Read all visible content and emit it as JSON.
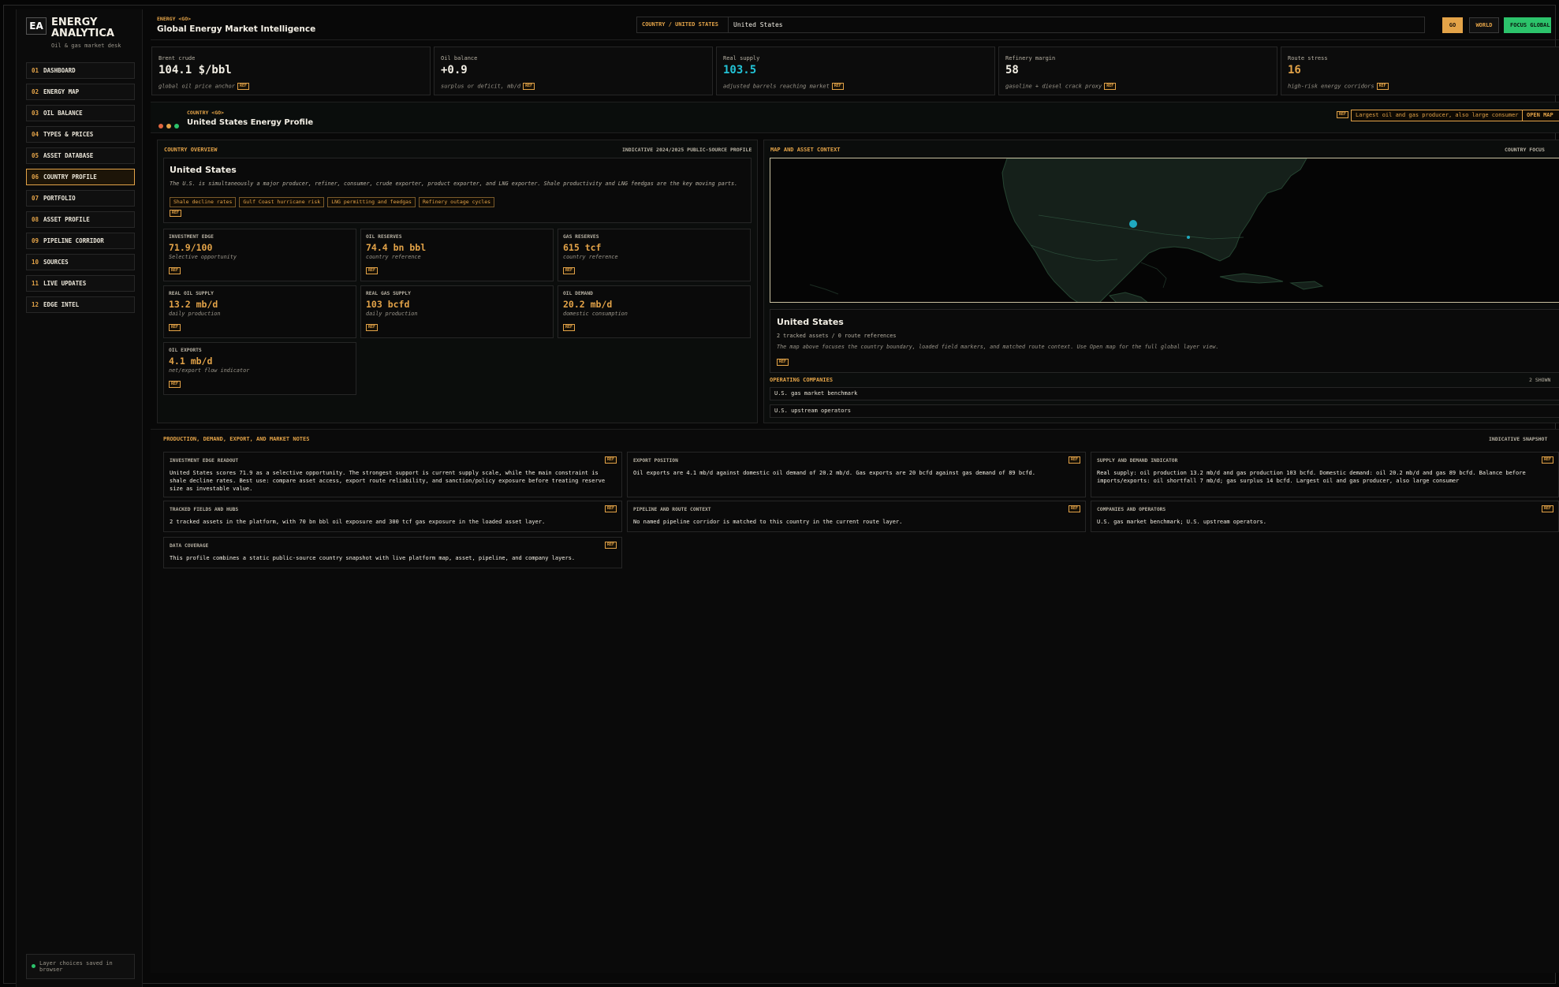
{
  "brand": {
    "logo": "EA",
    "name": "ENERGY ANALYTICA",
    "subtitle": "Oil & gas market desk"
  },
  "nav": [
    {
      "num": "01",
      "label": "DASHBOARD"
    },
    {
      "num": "02",
      "label": "ENERGY MAP"
    },
    {
      "num": "03",
      "label": "OIL BALANCE"
    },
    {
      "num": "04",
      "label": "TYPES & PRICES"
    },
    {
      "num": "05",
      "label": "ASSET DATABASE"
    },
    {
      "num": "06",
      "label": "COUNTRY PROFILE",
      "active": true
    },
    {
      "num": "07",
      "label": "PORTFOLIO"
    },
    {
      "num": "08",
      "label": "ASSET PROFILE"
    },
    {
      "num": "09",
      "label": "PIPELINE CORRIDOR"
    },
    {
      "num": "10",
      "label": "SOURCES"
    },
    {
      "num": "11",
      "label": "LIVE UPDATES"
    },
    {
      "num": "12",
      "label": "EDGE INTEL"
    }
  ],
  "footer_note": "Layer choices saved in browser",
  "header": {
    "kicker": "ENERGY <GO>",
    "title": "Global Energy Market Intelligence",
    "search_label": "COUNTRY / UNITED STATES",
    "search_value": "United States",
    "go_label": "GO",
    "world_label": "WORLD",
    "focus_label": "FOCUS GLOBAL"
  },
  "ref_label": "REF",
  "kpis": [
    {
      "label": "Brent crude",
      "value": "104.1 $/bbl",
      "note": "global oil price anchor",
      "tone": "white"
    },
    {
      "label": "Oil balance",
      "value": "+0.9",
      "note": "surplus or deficit, mb/d",
      "tone": "white"
    },
    {
      "label": "Real supply",
      "value": "103.5",
      "note": "adjusted barrels reaching market",
      "tone": "teal"
    },
    {
      "label": "Refinery margin",
      "value": "58",
      "note": "gasoline + diesel crack proxy",
      "tone": "white"
    },
    {
      "label": "Route stress",
      "value": "16",
      "note": "high-risk energy corridors",
      "tone": "orange"
    }
  ],
  "profile": {
    "kicker": "COUNTRY <GO>",
    "title": "United States Energy Profile",
    "tag": "Largest oil and gas producer, also large consumer",
    "open_label": "OPEN MAP"
  },
  "overview": {
    "title": "COUNTRY OVERVIEW",
    "right": "INDICATIVE 2024/2025 PUBLIC-SOURCE PROFILE",
    "name": "United States",
    "description": "The U.S. is simultaneously a major producer, refiner, consumer, crude exporter, product exporter, and LNG exporter. Shale productivity and LNG feedgas are the key moving parts.",
    "chips": [
      "Shale decline rates",
      "Gulf Coast hurricane risk",
      "LNG permitting and feedgas",
      "Refinery outage cycles"
    ],
    "metrics": [
      {
        "label": "INVESTMENT EDGE",
        "value": "71.9/100",
        "note": "Selective opportunity"
      },
      {
        "label": "OIL RESERVES",
        "value": "74.4 bn bbl",
        "note": "country reference"
      },
      {
        "label": "GAS RESERVES",
        "value": "615 tcf",
        "note": "country reference"
      },
      {
        "label": "REAL OIL SUPPLY",
        "value": "13.2 mb/d",
        "note": "daily production"
      },
      {
        "label": "REAL GAS SUPPLY",
        "value": "103 bcfd",
        "note": "daily production"
      },
      {
        "label": "OIL DEMAND",
        "value": "20.2 mb/d",
        "note": "domestic consumption"
      },
      {
        "label": "OIL EXPORTS",
        "value": "4.1 mb/d",
        "note": "net/export flow indicator"
      }
    ]
  },
  "map_panel": {
    "title": "MAP AND ASSET CONTEXT",
    "right": "COUNTRY FOCUS",
    "country": "United States",
    "sub": "2 tracked assets / 0 route references",
    "desc": "The map above focuses the country boundary, loaded field markers, and matched route context. Use Open map for the full global layer view.",
    "companies_title": "OPERATING COMPANIES",
    "companies_count": "2 SHOWN",
    "companies": [
      "U.S. gas market benchmark",
      "U.S. upstream operators"
    ],
    "colors": {
      "marker": "#1fa9bf",
      "land": "#152119",
      "border": "#2b4a36",
      "frame": "#c8c0a0"
    }
  },
  "notes": {
    "title": "PRODUCTION, DEMAND, EXPORT, AND MARKET NOTES",
    "right": "INDICATIVE SNAPSHOT",
    "items": [
      {
        "label": "INVESTMENT EDGE READOUT",
        "text": "United States scores 71.9 as a selective opportunity. The strongest support is current supply scale, while the main constraint is shale decline rates. Best use: compare asset access, export route reliability, and sanction/policy exposure before treating reserve size as investable value."
      },
      {
        "label": "EXPORT POSITION",
        "text": "Oil exports are 4.1 mb/d against domestic oil demand of 20.2 mb/d. Gas exports are 20 bcfd against gas demand of 89 bcfd."
      },
      {
        "label": "SUPPLY AND DEMAND INDICATOR",
        "text": "Real supply: oil production 13.2 mb/d and gas production 103 bcfd. Domestic demand: oil 20.2 mb/d and gas 89 bcfd. Balance before imports/exports: oil shortfall 7 mb/d; gas surplus 14 bcfd. Largest oil and gas producer, also large consumer"
      },
      {
        "label": "TRACKED FIELDS AND HUBS",
        "text": "2 tracked assets in the platform, with 70 bn bbl oil exposure and 300 tcf gas exposure in the loaded asset layer."
      },
      {
        "label": "PIPELINE AND ROUTE CONTEXT",
        "text": "No named pipeline corridor is matched to this country in the current route layer."
      },
      {
        "label": "COMPANIES AND OPERATORS",
        "text": "U.S. gas market benchmark; U.S. upstream operators."
      },
      {
        "label": "DATA COVERAGE",
        "text": "This profile combines a static public-source country snapshot with live platform map, asset, pipeline, and company layers."
      }
    ]
  },
  "colors": {
    "accent": "#e3a348",
    "teal": "#22c3d6",
    "green": "#2cc36b",
    "dot_red": "#e0663f",
    "dot_amber": "#e3a348",
    "dot_green": "#2cc36b"
  }
}
